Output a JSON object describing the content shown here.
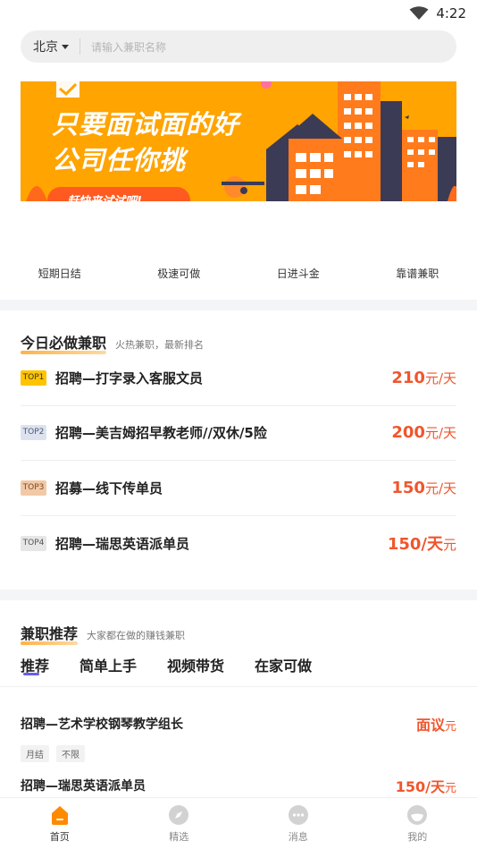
{
  "status": {
    "time": "4:22"
  },
  "search": {
    "city": "北京",
    "placeholder": "请输入兼职名称"
  },
  "banner": {
    "line1": "只要面试面的好",
    "line2": "公司任你挑",
    "button": "赶快来试试吧!"
  },
  "quick_nav": [
    "短期日结",
    "极速可做",
    "日进斗金",
    "靠谱兼职"
  ],
  "today": {
    "title": "今日必做兼职",
    "subtitle": "火热兼职，最新排名",
    "items": [
      {
        "badge": "TOP1",
        "title": "招聘—打字录入客服文员",
        "pay": "210",
        "unit": "元/天"
      },
      {
        "badge": "TOP2",
        "title": "招聘—美吉姆招早教老师//双休/5险",
        "pay": "200",
        "unit": "元/天"
      },
      {
        "badge": "TOP3",
        "title": "招募—线下传单员",
        "pay": "150",
        "unit": "元/天"
      },
      {
        "badge": "TOP4",
        "title": "招聘—瑞思英语派单员",
        "pay": "150/天",
        "unit": "元"
      }
    ]
  },
  "recommend": {
    "title": "兼职推荐",
    "subtitle": "大家都在做的赚钱兼职",
    "tabs": [
      "推荐",
      "简单上手",
      "视频带货",
      "在家可做"
    ],
    "items": [
      {
        "title": "招聘—艺术学校钢琴教学组长",
        "pay": "面议",
        "unit": "元",
        "tags": [
          "月结",
          "不限"
        ]
      },
      {
        "title": "招聘—瑞思英语派单员",
        "pay": "150/天",
        "unit": "元",
        "tags": []
      }
    ]
  },
  "bottom_nav": [
    {
      "label": "首页",
      "icon": "home-icon",
      "active": true
    },
    {
      "label": "精选",
      "icon": "compass-icon",
      "active": false
    },
    {
      "label": "消息",
      "icon": "message-icon",
      "active": false
    },
    {
      "label": "我的",
      "icon": "profile-icon",
      "active": false
    }
  ],
  "colors": {
    "accent": "#f0562d",
    "banner_bg": "#ffa400",
    "tab_indicator": "#6b5cf0",
    "active_nav": "#ff8a00"
  }
}
